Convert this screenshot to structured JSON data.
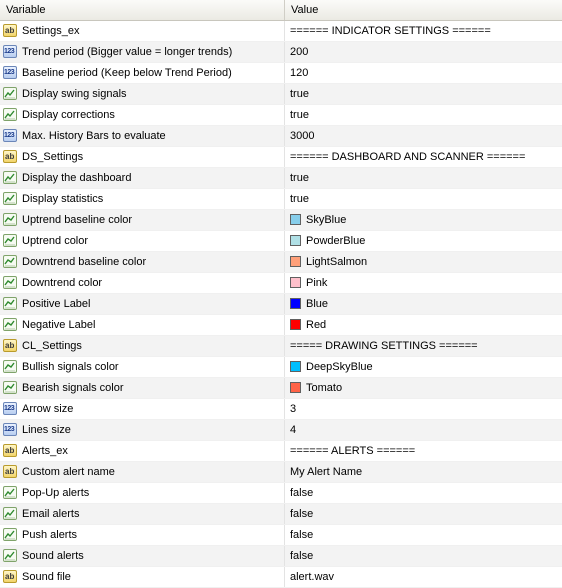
{
  "header": {
    "variable": "Variable",
    "value": "Value"
  },
  "rows": [
    {
      "icon": "ab-icon",
      "name": "Settings_ex",
      "value": "====== INDICATOR SETTINGS ======"
    },
    {
      "icon": "num-icon",
      "name": "Trend period (Bigger value = longer trends)",
      "value": "200"
    },
    {
      "icon": "num-icon",
      "name": "Baseline period (Keep below Trend Period)",
      "value": "120"
    },
    {
      "icon": "bool-icon",
      "name": "Display swing signals",
      "value": "true"
    },
    {
      "icon": "bool-icon",
      "name": "Display corrections",
      "value": "true"
    },
    {
      "icon": "num-icon",
      "name": "Max. History Bars to evaluate",
      "value": "3000"
    },
    {
      "icon": "ab-icon",
      "name": "DS_Settings",
      "value": "====== DASHBOARD AND SCANNER ======"
    },
    {
      "icon": "bool-icon",
      "name": "Display the dashboard",
      "value": "true"
    },
    {
      "icon": "bool-icon",
      "name": "Display statistics",
      "value": "true"
    },
    {
      "icon": "color-icon",
      "name": "Uptrend baseline color",
      "value": "SkyBlue",
      "swatch": "#87ceeb"
    },
    {
      "icon": "color-icon",
      "name": "Uptrend color",
      "value": "PowderBlue",
      "swatch": "#b0e0e6"
    },
    {
      "icon": "color-icon",
      "name": "Downtrend baseline color",
      "value": "LightSalmon",
      "swatch": "#ffa07a"
    },
    {
      "icon": "color-icon",
      "name": "Downtrend color",
      "value": "Pink",
      "swatch": "#ffc0cb"
    },
    {
      "icon": "color-icon",
      "name": "Positive Label",
      "value": "Blue",
      "swatch": "#0000ff"
    },
    {
      "icon": "color-icon",
      "name": "Negative Label",
      "value": "Red",
      "swatch": "#ff0000"
    },
    {
      "icon": "ab-icon",
      "name": "CL_Settings",
      "value": "===== DRAWING SETTINGS ======"
    },
    {
      "icon": "color-icon",
      "name": "Bullish signals color",
      "value": "DeepSkyBlue",
      "swatch": "#00bfff"
    },
    {
      "icon": "color-icon",
      "name": "Bearish signals color",
      "value": "Tomato",
      "swatch": "#ff6347"
    },
    {
      "icon": "num-icon",
      "name": "Arrow size",
      "value": "3"
    },
    {
      "icon": "num-icon",
      "name": "Lines size",
      "value": "4"
    },
    {
      "icon": "ab-icon",
      "name": "Alerts_ex",
      "value": "====== ALERTS ======"
    },
    {
      "icon": "ab-icon",
      "name": "Custom alert name",
      "value": "My Alert Name"
    },
    {
      "icon": "bool-icon",
      "name": "Pop-Up alerts",
      "value": "false"
    },
    {
      "icon": "bool-icon",
      "name": "Email alerts",
      "value": "false"
    },
    {
      "icon": "bool-icon",
      "name": "Push alerts",
      "value": "false"
    },
    {
      "icon": "bool-icon",
      "name": "Sound alerts",
      "value": "false"
    },
    {
      "icon": "ab-icon",
      "name": "Sound file",
      "value": "alert.wav"
    }
  ]
}
